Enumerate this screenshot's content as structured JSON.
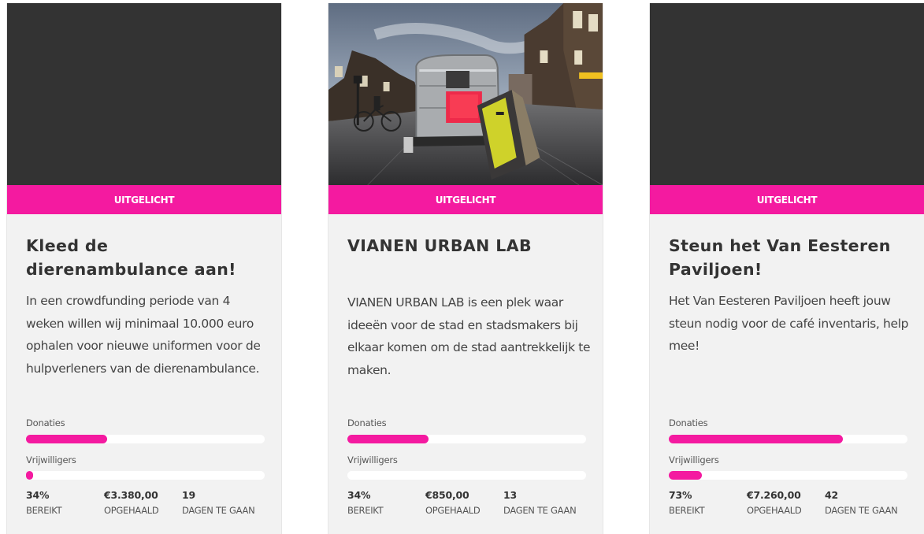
{
  "cards": [
    {
      "ribbon": "UITGELICHT",
      "title": "Kleed de dierenambulance aan!",
      "description": "In een crowdfunding periode van 4 weken willen wij minimaal 10.000 euro ophalen voor nieuwe uniformen voor de hulpverleners van de dierenambulance.",
      "image": "none",
      "donations_label": "Donaties",
      "donations_progress": 0.34,
      "volunteers_label": "Vrijwilligers",
      "volunteers_progress": 0.02,
      "percent": "34%",
      "percent_caption": "BEREIKT",
      "amount": "€3.380,00",
      "amount_caption": "OPGEHAALD",
      "days": "19",
      "days_caption": "DAGEN TE GAAN"
    },
    {
      "ribbon": "UITGELICHT",
      "title": "VIANEN URBAN LAB",
      "description": "VIANEN URBAN LAB is een plek waar ideeën voor de stad en stadsmakers bij elkaar komen om de stad aantrekkelijk te maken.",
      "image": "photo of a silver caravan on a cobblestone town street",
      "donations_label": "Donaties",
      "donations_progress": 0.34,
      "volunteers_label": "Vrijwilligers",
      "volunteers_progress": 0,
      "percent": "34%",
      "percent_caption": "BEREIKT",
      "amount": "€850,00",
      "amount_caption": "OPGEHAALD",
      "days": "13",
      "days_caption": "DAGEN TE GAAN"
    },
    {
      "ribbon": "UITGELICHT",
      "title": "Steun het Van Eesteren Paviljoen!",
      "description": "Het Van Eesteren Paviljoen heeft jouw steun nodig voor de café inventaris, help mee!",
      "image": "none",
      "donations_label": "Donaties",
      "donations_progress": 0.73,
      "volunteers_label": "Vrijwilligers",
      "volunteers_progress": 0.14,
      "percent": "73%",
      "percent_caption": "BEREIKT",
      "amount": "€7.260,00",
      "amount_caption": "OPGEHAALD",
      "days": "42",
      "days_caption": "DAGEN TE GAAN"
    }
  ],
  "colors": {
    "accent": "#f41aa0",
    "card_bg": "#f2f2f2",
    "image_placeholder": "#333333"
  }
}
